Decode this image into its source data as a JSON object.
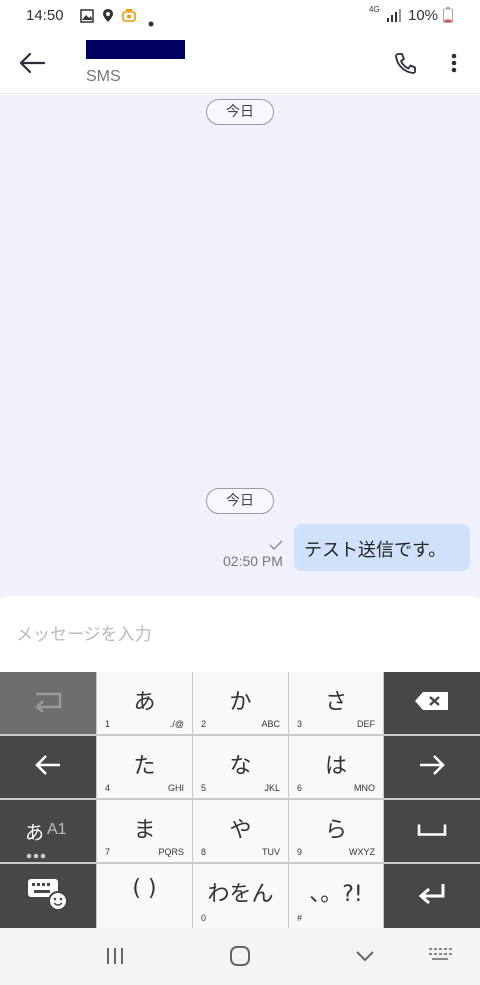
{
  "status_bar": {
    "time": "14:50",
    "network": "4G",
    "battery": "10%",
    "icons": [
      "image-icon",
      "location-icon",
      "app-notification-icon",
      "dot-icon",
      "signal-icon",
      "battery-icon"
    ]
  },
  "header": {
    "contact_sub": "SMS",
    "back_icon": "arrow-left-icon",
    "call_icon": "phone-icon",
    "more_icon": "more-vertical-icon"
  },
  "conversation": {
    "date_chips": [
      "今日",
      "今日"
    ],
    "messages": [
      {
        "text": "テスト送信です。",
        "time": "02:50 PM",
        "status": "sent",
        "direction": "outgoing"
      }
    ]
  },
  "compose": {
    "placeholder": "メッセージを入力",
    "value": ""
  },
  "keyboard": {
    "keys": [
      {
        "main": "あ",
        "num": "1",
        "letters": "./@"
      },
      {
        "main": "か",
        "num": "2",
        "letters": "ABC"
      },
      {
        "main": "さ",
        "num": "3",
        "letters": "DEF"
      },
      {
        "main": "た",
        "num": "4",
        "letters": "GHI"
      },
      {
        "main": "な",
        "num": "5",
        "letters": "JKL"
      },
      {
        "main": "は",
        "num": "6",
        "letters": "MNO"
      },
      {
        "main": "ま",
        "num": "7",
        "letters": "PQRS"
      },
      {
        "main": "や",
        "num": "8",
        "letters": "TUV"
      },
      {
        "main": "ら",
        "num": "9",
        "letters": "WXYZ"
      },
      {
        "main": "( )",
        "num": "",
        "letters": ""
      },
      {
        "main": "わをん",
        "num": "0",
        "letters": ""
      },
      {
        "main": "、。?!",
        "num": "#",
        "letters": ""
      }
    ],
    "mode_key": {
      "kana": "あ",
      "alnum": "A1"
    }
  },
  "colors": {
    "conversation_bg": "#f1f0fd",
    "bubble_bg": "#cfe1fb",
    "header_contact_redacted": "#00005f",
    "key_dark": "#474747",
    "key_light": "#f9f9f9"
  }
}
